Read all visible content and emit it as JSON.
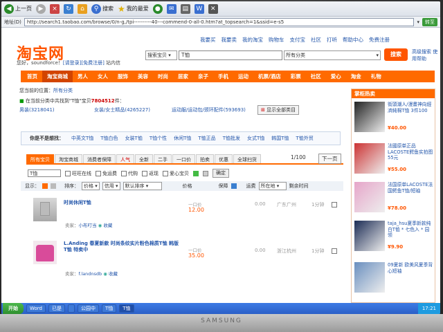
{
  "browser": {
    "back_label": "上一页",
    "search_label": "搜索",
    "favorites_label": "我的最爱",
    "address_label": "地址(D)",
    "address_value": "http://search1.taobao.com/browse/0/n-g,/tpi----------40---commend-0-all-0.htm?at_topsearch=1&ssid=e-s5",
    "go_label": "转至"
  },
  "page": {
    "top_links": [
      "我要买",
      "我要卖",
      "我的淘宝",
      "购物车",
      "支付宝",
      "社区",
      "打听",
      "帮助中心",
      "免费注册"
    ],
    "logo": "淘宝网",
    "welcome_prefix": "您好，soundforce！",
    "welcome_login": "[请登录]",
    "welcome_register": "[免费注册]",
    "welcome_suffix": "站内信",
    "search_category": "搜索宝贝",
    "search_query": "T恤",
    "search_scope": "所有分类",
    "search_button": "搜索",
    "advanced_search": "高级搜索 使用帮助",
    "nav": [
      "首页",
      "淘宝商城",
      "男人",
      "女人",
      "服饰",
      "美容",
      "时尚",
      "居家",
      "亲子",
      "手机",
      "运动",
      "机票/酒店",
      "彩票",
      "社区",
      "爱心",
      "淘金",
      "礼物"
    ],
    "crumb_prefix": "您当前的位置：",
    "crumb_link": "所有分类",
    "catinfo_prefix": "在当前分类中共找到\"T恤\"宝贝",
    "catinfo_count": "7804512",
    "catinfo_suffix": "件：",
    "cats": [
      {
        "label": "男装(3218041)"
      },
      {
        "label": "女装/女士精品(4265227)"
      },
      {
        "label": "运动服/运动包/颈环配件(593693)"
      }
    ],
    "show_all": "显示全部类目",
    "guess_label": "你是不是想找：",
    "guess_items": [
      "中英文T恤",
      "T恤白色",
      "女装T恤",
      "T恤个性",
      "休闲T恤",
      "T恤正品",
      "T恤批发",
      "女式T恤",
      "韩国T恤",
      "T恤外贸"
    ],
    "tabs": [
      "所有宝贝",
      "淘宝商城",
      "消费者保障",
      "人气",
      "全新",
      "二手",
      "一口价",
      "拍卖",
      "优惠",
      "全球扫货"
    ],
    "pager": "1/100",
    "next": "下一页",
    "filter_input": "T恤",
    "filter_opts": [
      "旺旺在线",
      "免运费",
      "代购",
      "返现",
      "爱心宝贝"
    ],
    "filter_confirm": "确定",
    "sort_show": "显示：",
    "sort_label": "排序：",
    "sort_price": "价格",
    "sort_credit": "信用",
    "sort_default": "默认排序",
    "col_price": "价格",
    "col_guarantee": "保障",
    "col_shipping": "运费",
    "col_location": "所在地",
    "col_time": "剩余时间",
    "items": [
      {
        "title": "时尚休闲T恤",
        "price_label": "一口价",
        "price": "12.00",
        "shipping": "0.00",
        "location": "广东广州",
        "time": "1分钟",
        "seller_prefix": "卖家：",
        "seller": "小布叮当",
        "fav": "收藏"
      },
      {
        "title": "L.Anding 春夏新款 时尚条纹实片粉色棉质T恤 韩版T恤 特卖中",
        "price_label": "一口价",
        "price": "35.00",
        "shipping": "0.00",
        "location": "浙江杭州",
        "time": "1分钟",
        "seller_prefix": "卖家：",
        "seller": "f.landnsdb",
        "fav": "收藏"
      }
    ],
    "side_title": "掌柜热卖",
    "side_products": [
      {
        "text": "街頭潮人/漫畫神向經濟純棉T恤 3件100",
        "price": "¥40.00",
        "color": "#222"
      },
      {
        "text": "法國原单正品LACOSTE鳄鱼实拍图 55元",
        "price": "¥55.00",
        "color": "#c33"
      },
      {
        "text": "法国原单LACOSTE法国鳄鱼T恤/短袖",
        "price": "¥78.00",
        "color": "#e6a5c9"
      },
      {
        "text": "taja_hsu夏季新款纯白T恤 * 七色入 * 园领",
        "price": "¥9.90",
        "color": "#1c2c55"
      },
      {
        "text": "09夏新 欧美风夏季背心短袖",
        "price": "",
        "color": "#6a8fbf"
      }
    ]
  },
  "taskbar": {
    "start": "开始",
    "tasks": [
      "Word",
      "已是",
      "",
      "公园中",
      "T恤",
      "T恤"
    ],
    "tray": "17:21"
  },
  "monitor_brand": "SAMSUNG"
}
